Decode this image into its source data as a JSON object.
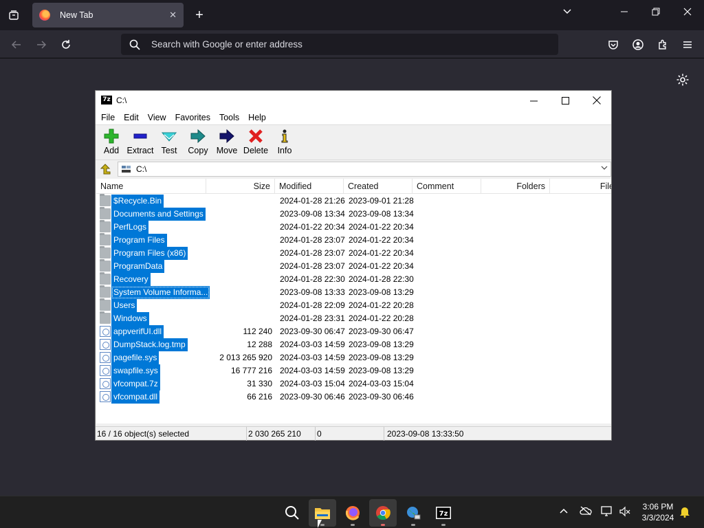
{
  "browser": {
    "tab_title": "New Tab",
    "search_placeholder": "Search with Google or enter address"
  },
  "window": {
    "title": "C:\\",
    "menu": [
      "File",
      "Edit",
      "View",
      "Favorites",
      "Tools",
      "Help"
    ],
    "toolbar": [
      {
        "label": "Add",
        "icon": "add-icon"
      },
      {
        "label": "Extract",
        "icon": "extract-icon"
      },
      {
        "label": "Test",
        "icon": "test-icon"
      },
      {
        "label": "Copy",
        "icon": "copy-icon"
      },
      {
        "label": "Move",
        "icon": "move-icon"
      },
      {
        "label": "Delete",
        "icon": "delete-icon"
      },
      {
        "label": "Info",
        "icon": "info-icon"
      }
    ],
    "path": "C:\\",
    "columns": [
      "Name",
      "Size",
      "Modified",
      "Created",
      "Comment",
      "Folders",
      "File"
    ],
    "rows": [
      {
        "name": "$Recycle.Bin",
        "type": "folder",
        "size": "",
        "modified": "2024-01-28 21:26",
        "created": "2023-09-01 21:28"
      },
      {
        "name": "Documents and Settings",
        "type": "folder",
        "size": "",
        "modified": "2023-09-08 13:34",
        "created": "2023-09-08 13:34"
      },
      {
        "name": "PerfLogs",
        "type": "folder",
        "size": "",
        "modified": "2024-01-22 20:34",
        "created": "2024-01-22 20:34"
      },
      {
        "name": "Program Files",
        "type": "folder",
        "size": "",
        "modified": "2024-01-28 23:07",
        "created": "2024-01-22 20:34"
      },
      {
        "name": "Program Files (x86)",
        "type": "folder",
        "size": "",
        "modified": "2024-01-28 23:07",
        "created": "2024-01-22 20:34"
      },
      {
        "name": "ProgramData",
        "type": "folder",
        "size": "",
        "modified": "2024-01-28 23:07",
        "created": "2024-01-22 20:34"
      },
      {
        "name": "Recovery",
        "type": "folder",
        "size": "",
        "modified": "2024-01-28 22:30",
        "created": "2024-01-28 22:30"
      },
      {
        "name": "System Volume Informa...",
        "type": "folder",
        "size": "",
        "modified": "2023-09-08 13:33",
        "created": "2023-09-08 13:29"
      },
      {
        "name": "Users",
        "type": "folder",
        "size": "",
        "modified": "2024-01-28 22:09",
        "created": "2024-01-22 20:28"
      },
      {
        "name": "Windows",
        "type": "folder",
        "size": "",
        "modified": "2024-01-28 23:31",
        "created": "2024-01-22 20:28"
      },
      {
        "name": "appverifUI.dll",
        "type": "file",
        "size": "112 240",
        "modified": "2023-09-30 06:47",
        "created": "2023-09-30 06:47"
      },
      {
        "name": "DumpStack.log.tmp",
        "type": "file",
        "size": "12 288",
        "modified": "2024-03-03 14:59",
        "created": "2023-09-08 13:29"
      },
      {
        "name": "pagefile.sys",
        "type": "file",
        "size": "2 013 265 920",
        "modified": "2024-03-03 14:59",
        "created": "2023-09-08 13:29"
      },
      {
        "name": "swapfile.sys",
        "type": "file",
        "size": "16 777 216",
        "modified": "2024-03-03 14:59",
        "created": "2023-09-08 13:29"
      },
      {
        "name": "vfcompat.7z",
        "type": "file",
        "size": "31 330",
        "modified": "2024-03-03 15:04",
        "created": "2024-03-03 15:04"
      },
      {
        "name": "vfcompat.dll",
        "type": "file",
        "size": "66 216",
        "modified": "2023-09-30 06:46",
        "created": "2023-09-30 06:46"
      }
    ],
    "status": {
      "selected": "16 / 16 object(s) selected",
      "total_size": "2 030 265 210",
      "packed": "0",
      "date": "2023-09-08 13:33:50"
    }
  },
  "taskbar": {
    "time": "3:06 PM",
    "date": "3/3/2024"
  }
}
